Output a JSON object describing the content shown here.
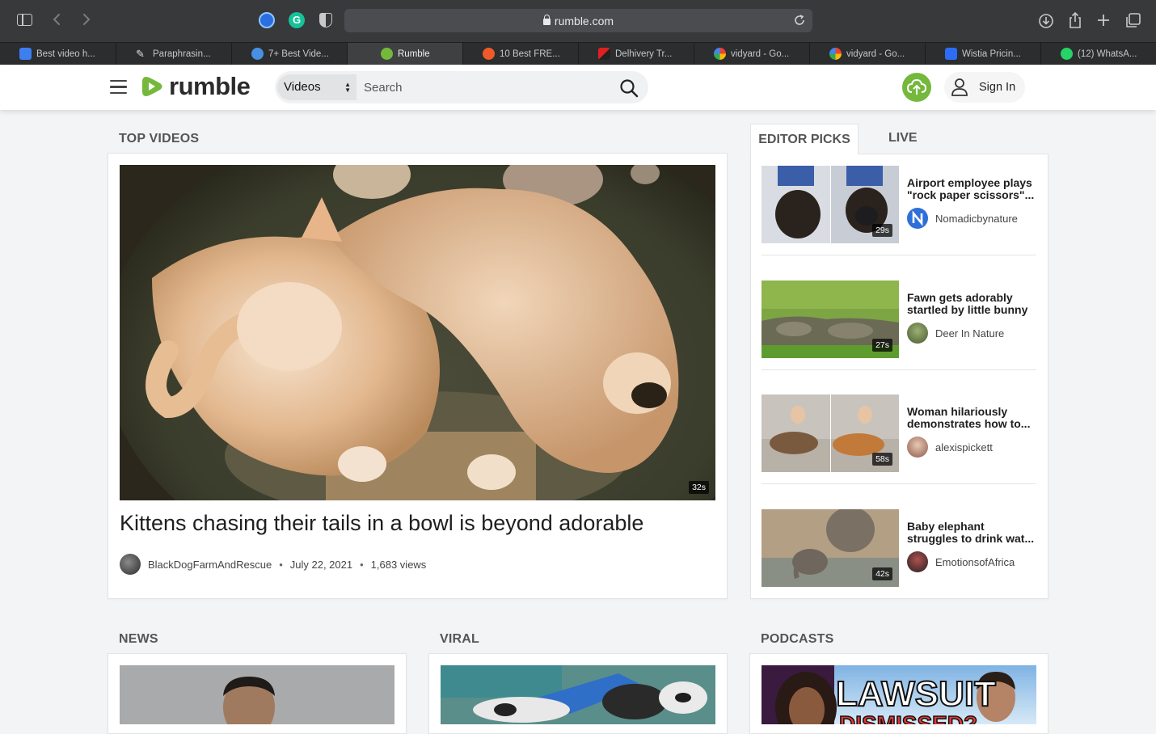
{
  "browser": {
    "url": "rumble.com",
    "tabs": [
      {
        "label": "Best video h...",
        "favicon": "docs-icon",
        "color": "#3d7ef0"
      },
      {
        "label": "Paraphrasin...",
        "favicon": "quill-icon",
        "color": "#d8d8d8"
      },
      {
        "label": "7+ Best Vide...",
        "favicon": "c-icon",
        "color": "#4a90e2"
      },
      {
        "label": "Rumble",
        "favicon": "rumble-icon",
        "color": "#74b83c",
        "active": true
      },
      {
        "label": "10 Best FRE...",
        "favicon": "orange-icon",
        "color": "#f05a28"
      },
      {
        "label": "Delhivery Tr...",
        "favicon": "delhivery-icon",
        "color": "#e02020"
      },
      {
        "label": "vidyard - Go...",
        "favicon": "google-icon",
        "color": "#ffffff"
      },
      {
        "label": "vidyard - Go...",
        "favicon": "google-icon",
        "color": "#ffffff"
      },
      {
        "label": "Wistia Pricin...",
        "favicon": "wistia-icon",
        "color": "#2d6df6"
      },
      {
        "label": "(12) WhatsA...",
        "favicon": "whatsapp-icon",
        "color": "#25d366"
      }
    ]
  },
  "header": {
    "logo_text": "rumble",
    "brand_color": "#74b83c",
    "search_scope": "Videos",
    "search_placeholder": "Search",
    "sign_in": "Sign In"
  },
  "top_videos": {
    "title": "TOP VIDEOS",
    "featured": {
      "title": "Kittens chasing their tails in a bowl is beyond adorable",
      "duration": "32s",
      "channel": "BlackDogFarmAndRescue",
      "date": "July 22, 2021",
      "views": "1,683 views"
    }
  },
  "editor_picks": {
    "tab_label": "EDITOR PICKS",
    "live_label": "LIVE",
    "items": [
      {
        "title_line1": "Airport employee plays",
        "title_line2": "\"rock paper scissors\"...",
        "channel": "Nomadicbynature",
        "duration": "29s"
      },
      {
        "title_line1": "Fawn gets adorably",
        "title_line2": "startled by little bunny",
        "channel": "Deer In Nature",
        "duration": "27s"
      },
      {
        "title_line1": "Woman hilariously",
        "title_line2": "demonstrates how to...",
        "channel": "alexispickett",
        "duration": "58s"
      },
      {
        "title_line1": "Baby elephant",
        "title_line2": "struggles to drink wat...",
        "channel": "EmotionsofAfrica",
        "duration": "42s"
      }
    ]
  },
  "sections": {
    "news": "NEWS",
    "viral": "VIRAL",
    "podcasts": "PODCASTS",
    "podcast_thumb_text1": "LAWSUIT",
    "podcast_thumb_text2": "DISMISSED?"
  }
}
